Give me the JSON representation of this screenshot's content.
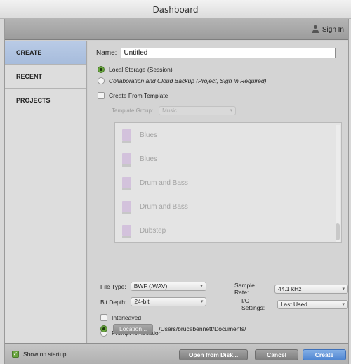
{
  "window": {
    "title": "Dashboard"
  },
  "topbar": {
    "signin_label": "Sign In",
    "signin_icon": "user-icon"
  },
  "sidebar": {
    "items": [
      {
        "label": "CREATE",
        "active": true
      },
      {
        "label": "RECENT",
        "active": false
      },
      {
        "label": "PROJECTS",
        "active": false
      }
    ]
  },
  "create": {
    "name_label": "Name:",
    "name_value": "Untitled",
    "storage_local": "Local Storage (Session)",
    "storage_cloud": "Collaboration and Cloud Backup (Project, Sign In Required)",
    "from_template": "Create From Template",
    "template_group_label": "Template Group:",
    "template_group_value": "Music",
    "templates": [
      "Blues",
      "Blues",
      "Drum and Bass",
      "Drum and Bass",
      "Dubstep"
    ],
    "file_type_label": "File Type:",
    "file_type_value": "BWF (.WAV)",
    "sample_rate_label": "Sample Rate:",
    "sample_rate_value": "44.1 kHz",
    "bit_depth_label": "Bit Depth:",
    "bit_depth_value": "24-bit",
    "io_label": "I/O Settings:",
    "io_value": "Last Used",
    "interleaved": "Interleaved",
    "prompt_location": "Prompt for location",
    "location_button": "Location...",
    "location_path": "/Users/brucebennett/Documents/"
  },
  "footer": {
    "show_on_startup": "Show on startup",
    "open_from_disk": "Open from Disk...",
    "cancel": "Cancel",
    "create": "Create"
  },
  "colors": {
    "accent_green": "#6aa63f",
    "accent_blue": "#4f86d2",
    "sidebar_active": "#b9cbe6"
  }
}
